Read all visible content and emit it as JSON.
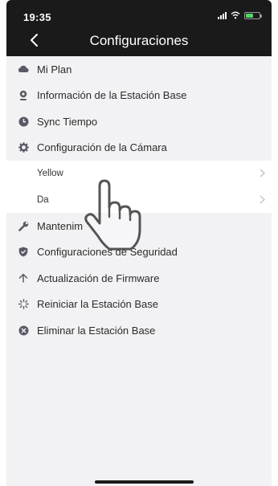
{
  "status_bar": {
    "time": "19:35",
    "battery_level": 0.55
  },
  "header": {
    "title": "Configuraciones"
  },
  "menu": {
    "items": [
      {
        "label": "Mi Plan",
        "icon": "cloud-icon"
      },
      {
        "label": "Información de la Estación Base",
        "icon": "camera-icon"
      },
      {
        "label": "Sync Tiempo",
        "icon": "clock-icon"
      },
      {
        "label": "Configuración de la Cámara",
        "icon": "gear-icon"
      }
    ],
    "camera_sub_items": [
      {
        "label": "Yellow"
      },
      {
        "label": "Da"
      }
    ],
    "items_after": [
      {
        "label": "Mantenim",
        "icon": "wrench-icon"
      },
      {
        "label": "Configuraciones de Seguridad",
        "icon": "shield-icon"
      },
      {
        "label": "Actualización de Firmware",
        "icon": "arrow-up-icon"
      },
      {
        "label": "Reiniciar la Estación Base",
        "icon": "restart-icon"
      },
      {
        "label": "Eliminar la Estación Base",
        "icon": "close-circle-icon"
      }
    ]
  },
  "colors": {
    "header_bg": "#1a1a1a",
    "list_bg": "#f2f2f4",
    "icon": "#5a5a66",
    "battery_fill": "#4cd964"
  }
}
